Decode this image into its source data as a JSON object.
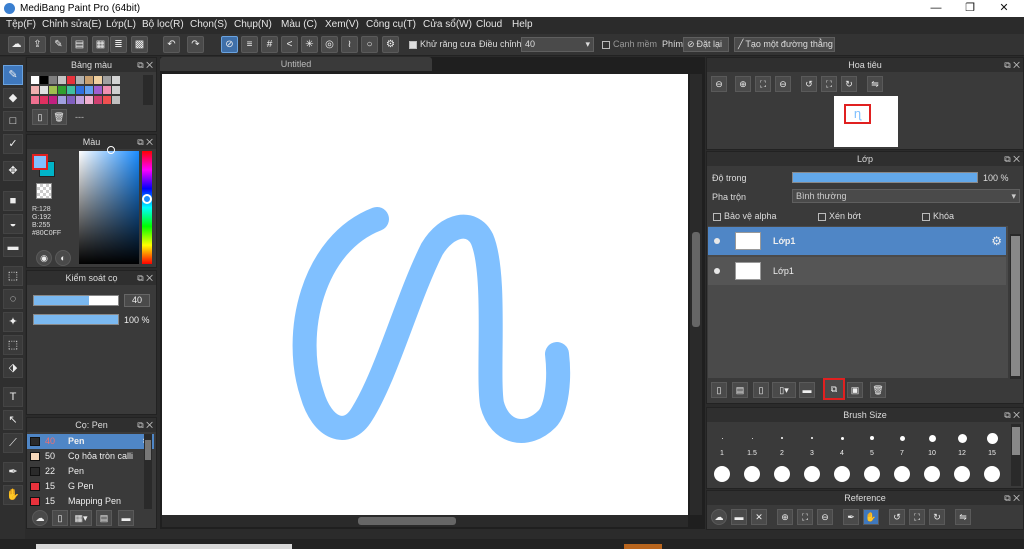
{
  "title_bar": {
    "title": "MediBang Paint Pro (64bit)",
    "minimize": "—",
    "maximize": "❐",
    "close": "✕"
  },
  "menu": [
    "Tệp(F)",
    "Chỉnh sửa(E)",
    "Lớp(L)",
    "Bộ lọc(R)",
    "Chọn(S)",
    "Chụp(N)",
    "Màu (C)",
    "Xem(V)",
    "Công cụ(T)",
    "Cửa sổ(W)",
    "Cloud",
    "Help"
  ],
  "toolbar": {
    "antialias_label": "Khử răng cưa",
    "correction_label": "Điều chỉnh",
    "correction_value": "40",
    "edge_label": "Cạnh mềm",
    "key_label": "Phím",
    "reset_label": "Đặt lại",
    "line_label": "Tạo một đường thẳng"
  },
  "palette_panel": {
    "title": "Bảng màu",
    "extra": "---"
  },
  "color_panel": {
    "title": "Màu",
    "r": "R:128",
    "g": "G:192",
    "b": "B:255",
    "hex": "#80C0FF",
    "primary_color": "#80C0FF",
    "secondary_color": "#00B4C8"
  },
  "brush_control": {
    "title": "Kiểm soát cọ",
    "size": "40",
    "opacity": "100 %"
  },
  "brush_panel": {
    "title": "Cọ: Pen",
    "items": [
      {
        "size": "40",
        "name": "Pen",
        "color": "#2a2a2a",
        "selected": true
      },
      {
        "size": "50",
        "name": "Cọ hỏa tròn calli",
        "color": "#f5d6b8",
        "selected": false
      },
      {
        "size": "22",
        "name": "Pen",
        "color": "#2a2a2a",
        "selected": false
      },
      {
        "size": "15",
        "name": "G Pen",
        "color": "#e8323c",
        "selected": false
      },
      {
        "size": "15",
        "name": "Mapping Pen",
        "color": "#e8323c",
        "selected": false
      }
    ]
  },
  "document": {
    "tab_title": "Untitled"
  },
  "navigator": {
    "title": "Hoa tiêu"
  },
  "layer_panel": {
    "title": "Lớp",
    "opacity_label": "Độ trong",
    "opacity_value": "100 %",
    "blend_label": "Pha trộn",
    "blend_value": "Bình thường",
    "protect_alpha": "Bảo vệ alpha",
    "clipping": "Xén bớt",
    "lock": "Khóa",
    "layers": [
      {
        "name": "Lớp1",
        "selected": true
      },
      {
        "name": "Lớp1",
        "selected": false
      }
    ]
  },
  "brush_size_panel": {
    "title": "Brush Size",
    "sizes": [
      "1",
      "1.5",
      "2",
      "3",
      "4",
      "5",
      "7",
      "10",
      "12",
      "15"
    ]
  },
  "reference_panel": {
    "title": "Reference"
  },
  "colors": {
    "accent": "#3f78bd",
    "stroke": "#80C0FF",
    "highlight_red": "#e02020"
  }
}
